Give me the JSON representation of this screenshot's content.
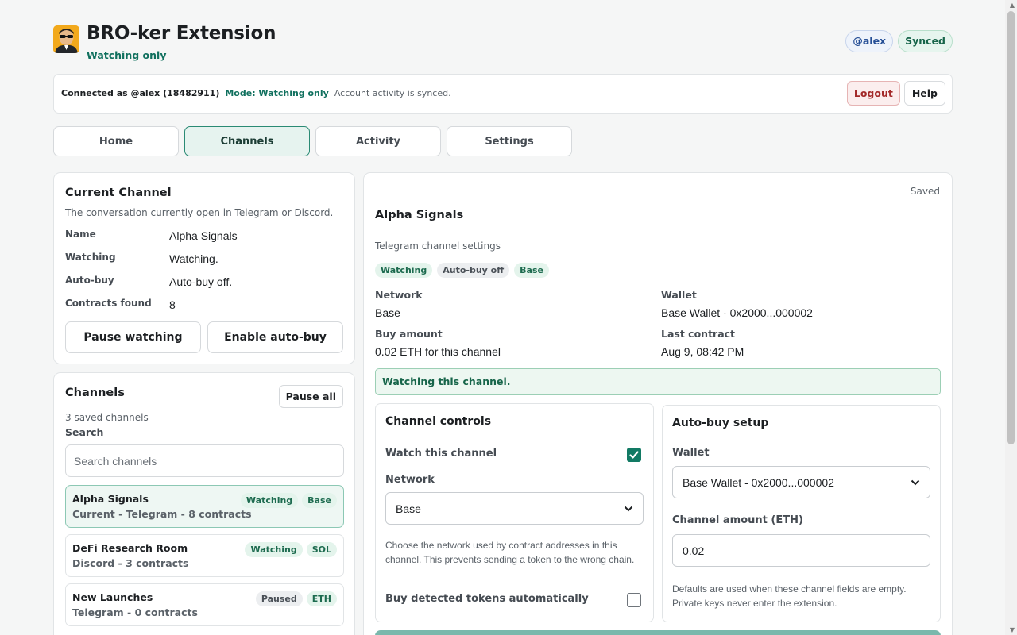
{
  "header": {
    "app_title": "BRO-ker Extension",
    "subtitle": "Watching only",
    "user_badge": "@alex",
    "sync_badge": "Synced"
  },
  "connection": {
    "connected_as": "Connected as @alex (18482911)",
    "mode": "Mode: Watching only",
    "status": "Account activity is synced.",
    "logout_label": "Logout",
    "help_label": "Help"
  },
  "tabs": [
    {
      "label": "Home",
      "active": false
    },
    {
      "label": "Channels",
      "active": true
    },
    {
      "label": "Activity",
      "active": false
    },
    {
      "label": "Settings",
      "active": false
    }
  ],
  "current_channel": {
    "title": "Current Channel",
    "description": "The conversation currently open in Telegram or Discord.",
    "rows": [
      {
        "key": "Name",
        "value": "Alpha Signals"
      },
      {
        "key": "Watching",
        "value": "Watching."
      },
      {
        "key": "Auto-buy",
        "value": "Auto-buy off."
      },
      {
        "key": "Contracts found",
        "value": "8"
      }
    ],
    "pause_label": "Pause watching",
    "enable_label": "Enable auto-buy"
  },
  "channels": {
    "title": "Channels",
    "pause_all_label": "Pause all",
    "count_text": "3 saved channels",
    "search_label": "Search",
    "search_placeholder": "Search channels",
    "items": [
      {
        "name": "Alpha Signals",
        "meta": "Current - Telegram - 8 contracts",
        "status": "Watching",
        "network": "Base",
        "selected": true
      },
      {
        "name": "DeFi Research Room",
        "meta": "Discord - 3 contracts",
        "status": "Watching",
        "network": "SOL",
        "selected": false
      },
      {
        "name": "New Launches",
        "meta": "Telegram - 0 contracts",
        "status": "Paused",
        "network": "ETH",
        "selected": false
      }
    ]
  },
  "detail": {
    "saved_text": "Saved",
    "title": "Alpha Signals",
    "subtitle": "Telegram channel settings",
    "tags": [
      "Watching",
      "Auto-buy off",
      "Base"
    ],
    "network_label": "Network",
    "network_value": "Base",
    "wallet_label": "Wallet",
    "wallet_value": "Base Wallet · 0x2000...000002",
    "buy_amount_label": "Buy amount",
    "buy_amount_value": "0.02 ETH for this channel",
    "last_contract_label": "Last contract",
    "last_contract_value": "Aug 9, 08:42 PM",
    "notice": "Watching this channel."
  },
  "channel_controls": {
    "title": "Channel controls",
    "watch_label": "Watch this channel",
    "watch_checked": true,
    "network_label": "Network",
    "network_value": "Base",
    "network_help": "Choose the network used by contract addresses in this channel. This prevents sending a token to the wrong chain.",
    "autobuy_label": "Buy detected tokens automatically",
    "autobuy_checked": false
  },
  "autobuy_setup": {
    "title": "Auto-buy setup",
    "wallet_label": "Wallet",
    "wallet_value": "Base Wallet - 0x2000...000002",
    "amount_label": "Channel amount (ETH)",
    "amount_value": "0.02",
    "help": "Defaults are used when these channel fields are empty. Private keys never enter the extension."
  },
  "colors": {
    "accent": "#127a64",
    "accent_text": "#10705e",
    "logout_red": "#a32a2a"
  }
}
